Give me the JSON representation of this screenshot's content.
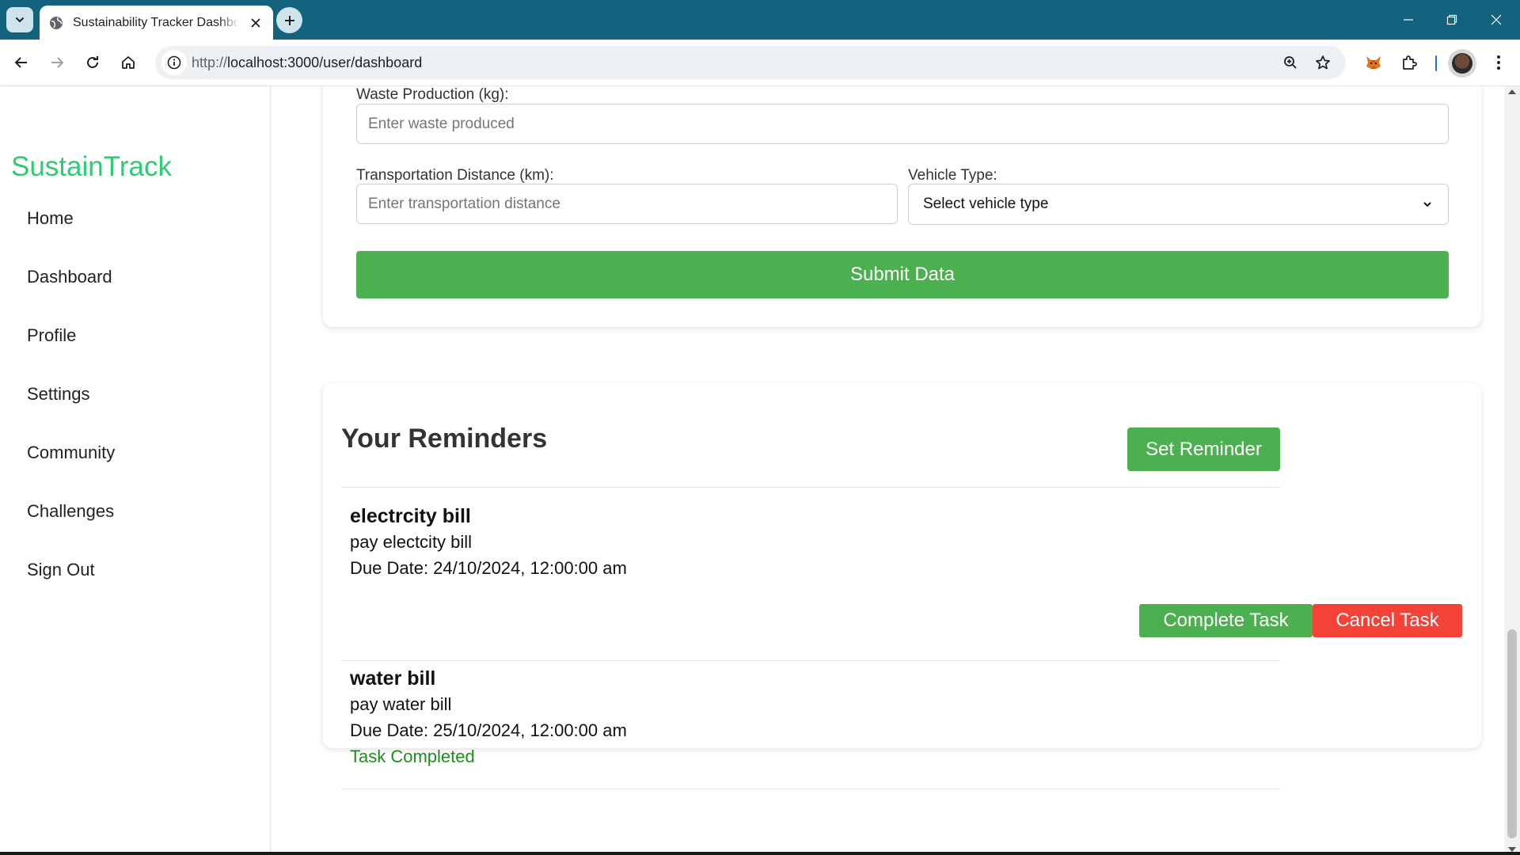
{
  "browser": {
    "tab_title": "Sustainability Tracker Dashboard",
    "url_scheme": "http://",
    "url_host_path": "localhost:3000/user/dashboard"
  },
  "sidebar": {
    "brand": "SustainTrack",
    "brand_color": "#2ecc71",
    "items": [
      {
        "label": "Home"
      },
      {
        "label": "Dashboard"
      },
      {
        "label": "Profile"
      },
      {
        "label": "Settings"
      },
      {
        "label": "Community"
      },
      {
        "label": "Challenges"
      },
      {
        "label": "Sign Out"
      }
    ]
  },
  "form": {
    "waste_label": "Waste Production (kg):",
    "waste_placeholder": "Enter waste produced",
    "distance_label": "Transportation Distance (km):",
    "distance_placeholder": "Enter transportation distance",
    "vehicle_label": "Vehicle Type:",
    "vehicle_selected": "Select vehicle type",
    "submit_label": "Submit Data"
  },
  "reminders": {
    "title": "Your Reminders",
    "set_reminder_label": "Set Reminder",
    "items": [
      {
        "title": "electrcity bill",
        "description": "pay electcity bill",
        "due": "Due Date: 24/10/2024, 12:00:00 am",
        "complete_label": "Complete Task",
        "cancel_label": "Cancel Task"
      },
      {
        "title": "water bill",
        "description": "pay water bill",
        "due": "Due Date: 25/10/2024, 12:00:00 am",
        "status": "Task Completed"
      }
    ]
  },
  "colors": {
    "accent_green": "#4caf50",
    "danger_red": "#f44336",
    "chrome_tab_bar": "#13637f"
  }
}
